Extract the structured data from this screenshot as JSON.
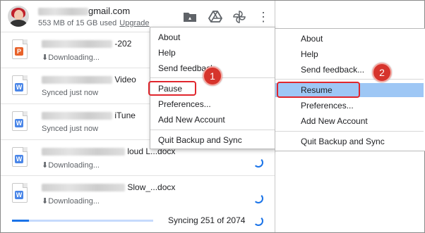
{
  "account": {
    "email_suffix": "gmail.com",
    "storage_used": "553 MB of 15 GB used",
    "upgrade_label": "Upgrade"
  },
  "header_icons": [
    "folder-drive-icon",
    "google-drive-icon",
    "photos-pinwheel-icon",
    "more-vert-icon"
  ],
  "files": [
    {
      "name_visible": "-202",
      "status": "Downloading...",
      "type": "pdf",
      "has_arrow": true,
      "spinner": false
    },
    {
      "name_visible": "Video",
      "status": "Synced just now",
      "type": "word",
      "has_arrow": false,
      "spinner": false
    },
    {
      "name_visible": "iTune",
      "status": "Synced just now",
      "type": "word",
      "has_arrow": false,
      "spinner": false
    },
    {
      "name_visible": "loud L...docx",
      "status": "Downloading...",
      "type": "word",
      "has_arrow": true,
      "spinner": true
    },
    {
      "name_visible": "Slow_...docx",
      "status": "Downloading...",
      "type": "word",
      "has_arrow": true,
      "spinner": true
    }
  ],
  "footer": {
    "sync_status": "Syncing 251 of 2074",
    "progress": 0.121
  },
  "menu_running": {
    "items": [
      "About",
      "Help",
      "Send feedback",
      "Pause",
      "Preferences...",
      "Add New Account",
      "Quit Backup and Sync"
    ]
  },
  "menu_paused": {
    "items": [
      "About",
      "Help",
      "Send feedback...",
      "Resume",
      "Preferences...",
      "Add New Account",
      "Quit Backup and Sync"
    ]
  },
  "steps": [
    "1",
    "2"
  ],
  "colors": {
    "accent": "#1a73e8",
    "highlight": "#9ec7f5",
    "annotation_red": "#e0262d"
  }
}
